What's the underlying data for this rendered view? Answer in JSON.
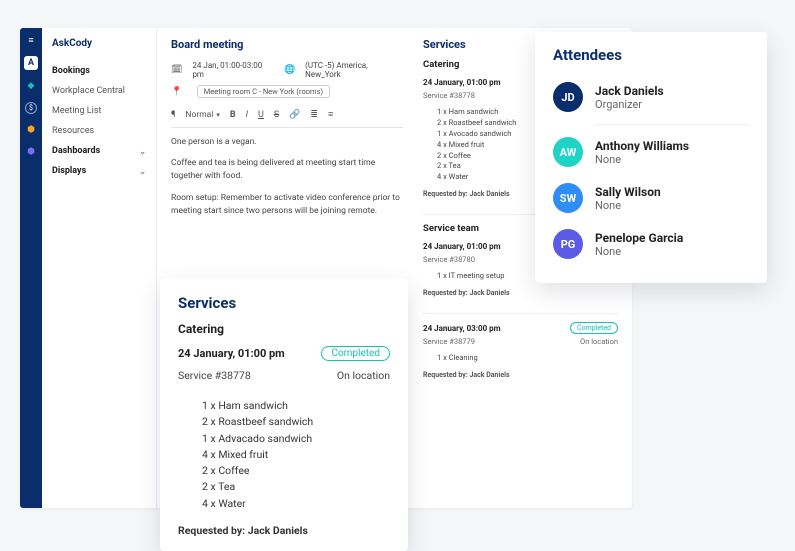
{
  "app_name": "AskCody",
  "sidebar": {
    "items": [
      {
        "label": "Bookings",
        "bold": true
      },
      {
        "label": "Workplace Central"
      },
      {
        "label": "Meeting List"
      },
      {
        "label": "Resources"
      },
      {
        "label": "Dashboards",
        "chevron": true
      },
      {
        "label": "Displays",
        "chevron": true
      }
    ]
  },
  "rail_icons": [
    "menu",
    "logo-A",
    "cube-teal",
    "dollar",
    "hex-orange",
    "hex-purple"
  ],
  "page": {
    "title": "Board meeting",
    "datetime": "24 Jan, 01:00-03:00 pm",
    "timezone": "(UTC -5) America, New_York",
    "room": "Meeting room C - New York (rooms)",
    "toolbar": {
      "para": "¶",
      "style": "Normal",
      "bold": "B",
      "italic": "I",
      "underline": "U",
      "strike": "S",
      "link": "🔗",
      "ol": "≣",
      "ul": "≡"
    },
    "body": [
      "One person is a vegan.",
      "Coffee and tea is being delivered at meeting start time together with food.",
      "Room setup: Remember to activate video conference prior to meeting start since two persons will be joining remote."
    ]
  },
  "services_panel": {
    "title": "Services",
    "sections": [
      {
        "name": "Catering",
        "entries": [
          {
            "when": "24 January, 01:00 pm",
            "status": "Completed",
            "id": "Service #38778",
            "loc": "On location",
            "items": [
              "1 x Ham sandwich",
              "2 x Roastbeef sandwich",
              "1 x Avocado sandwich",
              "4 x Mixed fruit",
              "2 x Coffee",
              "2 x Tea",
              "4 x Water"
            ],
            "requested_by": "Requested by: Jack Daniels"
          }
        ]
      },
      {
        "name": "Service team",
        "entries": [
          {
            "when": "24 January, 01:00 pm",
            "status": "Completed",
            "id": "Service #38780",
            "loc": "On location",
            "items": [
              "1 x IT meeting setup"
            ],
            "requested_by": "Requested by: Jack Daniels"
          },
          {
            "when": "24 January, 03:00 pm",
            "status": "Completed",
            "id": "Service #38779",
            "loc": "On location",
            "items": [
              "1 x Cleaning"
            ],
            "requested_by": "Requested by: Jack Daniels"
          }
        ]
      }
    ]
  },
  "services_card": {
    "title": "Services",
    "category": "Catering",
    "when": "24 January, 01:00 pm",
    "status": "Completed",
    "id": "Service #38778",
    "loc": "On location",
    "items": [
      "1 x Ham sandwich",
      "2 x Roastbeef sandwich",
      "1 x Advacado sandwich",
      "4 x Mixed fruit",
      "2 x Coffee",
      "2 x Tea",
      "4 x Water"
    ],
    "requested_by": "Requested by: Jack Daniels"
  },
  "attendees_card": {
    "title": "Attendees",
    "people": [
      {
        "initials": "JD",
        "name": "Jack Daniels",
        "role": "Organizer",
        "color": "navy"
      },
      {
        "initials": "AW",
        "name": "Anthony Williams",
        "role": "None",
        "color": "teal"
      },
      {
        "initials": "SW",
        "name": "Sally Wilson",
        "role": "None",
        "color": "blue"
      },
      {
        "initials": "PG",
        "name": "Penelope Garcia",
        "role": "None",
        "color": "purple"
      }
    ]
  }
}
